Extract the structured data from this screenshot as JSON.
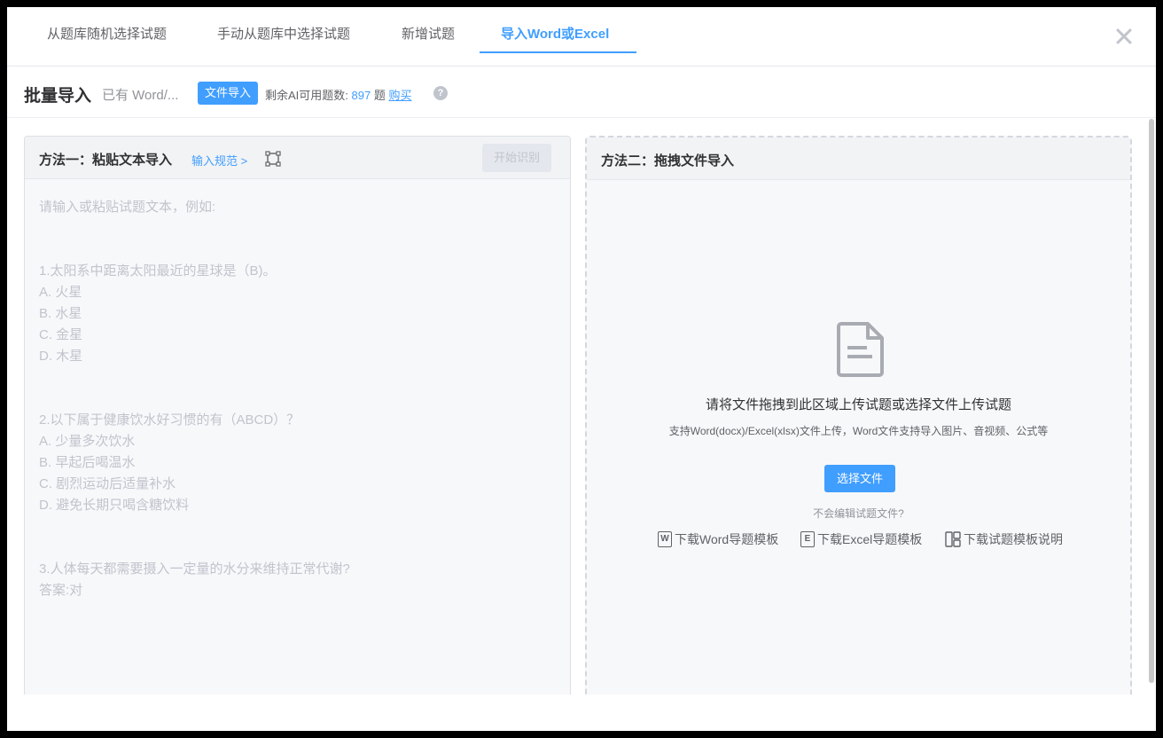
{
  "tabs": [
    {
      "label": "从题库随机选择试题"
    },
    {
      "label": "手动从题库中选择试题"
    },
    {
      "label": "新增试题"
    },
    {
      "label": "导入Word或Excel"
    }
  ],
  "close_glyph": "×",
  "header": {
    "title": "批量导入",
    "subtitle": "已有 Word/...",
    "badge": "文件导入",
    "remain_label": "剩余AI可用题数:",
    "remain_count": "897",
    "remain_unit": "题",
    "buy": "购买",
    "help_glyph": "?"
  },
  "left_panel": {
    "title": "方法一：粘贴文本导入",
    "spec_link": "输入规范 >",
    "start_button": "开始识别",
    "placeholder_lines": [
      "请输入或粘贴试题文本，例如:",
      "1.太阳系中距离太阳最近的星球是（B)。",
      "A. 火星",
      "B. 水星",
      "C. 金星",
      "D. 木星",
      "2.以下属于健康饮水好习惯的有（ABCD）？",
      "A. 少量多次饮水",
      "B. 早起后喝温水",
      "C. 剧烈运动后适量补水",
      "D. 避免长期只喝含糖饮料",
      "3.人体每天都需要摄入一定量的水分来维持正常代谢?",
      "答案:对"
    ]
  },
  "right_panel": {
    "title": "方法二：拖拽文件导入",
    "drop_title": "请将文件拖拽到此区域上传试题或选择文件上传试题",
    "drop_sub": "支持Word(docx)/Excel(xlsx)文件上传，Word文件支持导入图片、音视频、公式等",
    "choose_button": "选择文件",
    "no_edit": "不会编辑试题文件?",
    "downloads": [
      {
        "icon": "W",
        "label": "下载Word导题模板"
      },
      {
        "icon": "E",
        "label": "下载Excel导题模板"
      },
      {
        "icon": "",
        "label": "下载试题模板说明"
      }
    ]
  },
  "colors": {
    "accent": "#409eff",
    "text_primary": "#303133",
    "placeholder": "#c0c4cc"
  }
}
